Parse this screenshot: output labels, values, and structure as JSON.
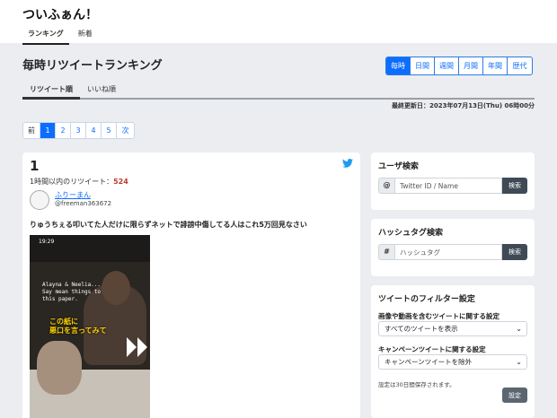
{
  "app": {
    "title": "ついふぁん！"
  },
  "nav": {
    "items": [
      "ランキング",
      "新着"
    ]
  },
  "page": {
    "title": "毎時リツイートランキング"
  },
  "periods": [
    "毎時",
    "日間",
    "週間",
    "月間",
    "年間",
    "歴代"
  ],
  "sort_tabs": [
    "リツイート順",
    "いいね順"
  ],
  "updated": "最終更新日：2023年07月13日(Thu) 06時00分",
  "pager": [
    "前",
    "1",
    "2",
    "3",
    "4",
    "5",
    "次"
  ],
  "tweet": {
    "rank": "1",
    "rt_label": "1時間以内のリツイート：",
    "rt_count": "524",
    "user_name": "ふりーまん",
    "user_handle": "@freeman363672",
    "text": "りゅうちぇる叩いてた人だけに限らずネットで誹謗中傷してる人はこれ5万回見なさい",
    "media": {
      "time": "19:29",
      "caption": "Alayna & Neelia...\nSay mean things to\nthis paper.",
      "caption_ja": "この紙に\n悪口を言ってみて"
    }
  },
  "user_search": {
    "title": "ユーザ検索",
    "addon": "@",
    "placeholder": "Twitter ID / Name",
    "button": "検索"
  },
  "hashtag_search": {
    "title": "ハッシュタグ検索",
    "addon": "#",
    "placeholder": "ハッシュタグ",
    "button": "検索"
  },
  "filter": {
    "title": "ツイートのフィルター設定",
    "media_label": "画像や動画を含むツイートに関する設定",
    "media_value": "すべてのツイートを表示",
    "campaign_label": "キャンペーンツイートに関する設定",
    "campaign_value": "キャンペーンツイートを除外",
    "note": "設定は30日間保存されます。",
    "save": "設定"
  },
  "colors": {
    "accent": "#0d6efd",
    "rt_count": "#c0392b",
    "dark_button": "#3f4a56",
    "twitter": "#1d9bf0"
  },
  "icons": {
    "brand": "twitter-bird-icon",
    "play": "play-icon",
    "chevron": "chevron-down-icon"
  }
}
